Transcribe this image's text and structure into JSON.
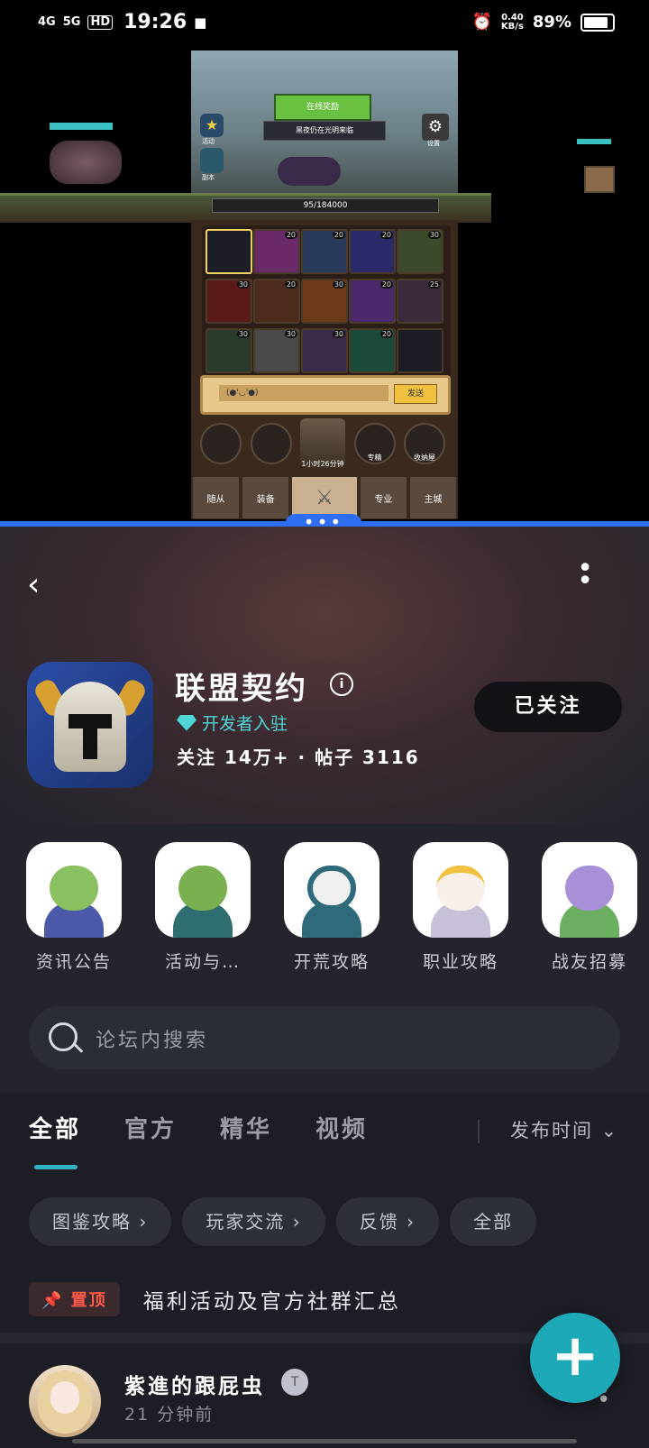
{
  "status_bar": {
    "network": "4G",
    "network2": "5G",
    "hd": "HD",
    "time": "19:26",
    "speed": "0.40",
    "speed_unit": "KB/s",
    "battery": "89%"
  },
  "game": {
    "top_button": "在线奖励",
    "banner_text": "黑夜仍在光明来临",
    "left_menu_1": "活动",
    "left_menu_2": "副本",
    "settings_label": "设置",
    "hp_text": "95/184000",
    "chat_placeholder": "(●'◡'●)",
    "chat_send": "发送",
    "chest_timer": "1小时26分钟",
    "round_icons": [
      "",
      "",
      "",
      "专精",
      "收纳屋"
    ],
    "tabs": [
      "随从",
      "装备",
      "",
      "专业",
      "主城"
    ]
  },
  "app": {
    "title": "联盟契约",
    "developer_label": "开发者入驻",
    "stats": "关注 14万+ · 帖子 3116",
    "follow_label": "已关注",
    "categories": [
      {
        "label": "资讯公告",
        "head": "#8ac060",
        "body": "#4a5aa8"
      },
      {
        "label": "活动与…",
        "head": "#7ab050",
        "body": "#2e6e70"
      },
      {
        "label": "开荒攻略",
        "head": "#2e6a7a",
        "body": "#2e6a7a"
      },
      {
        "label": "职业攻略",
        "head": "#f0e8e0",
        "body": "#c8c0d8"
      },
      {
        "label": "战友招募",
        "head": "#a890d8",
        "body": "#6ab060"
      }
    ],
    "search_placeholder": "论坛内搜索",
    "tabs": [
      "全部",
      "官方",
      "精华",
      "视频"
    ],
    "sort_label": "发布时间 ⌄",
    "chips": [
      "图鉴攻略 ›",
      "玩家交流 ›",
      "反馈 ›",
      "全部"
    ],
    "pin_badge": "📌 置顶",
    "pin_title": "福利活动及官方社群汇总",
    "post": {
      "author": "紫進的跟屁虫",
      "badge": "T",
      "time": "21 分钟前"
    }
  }
}
